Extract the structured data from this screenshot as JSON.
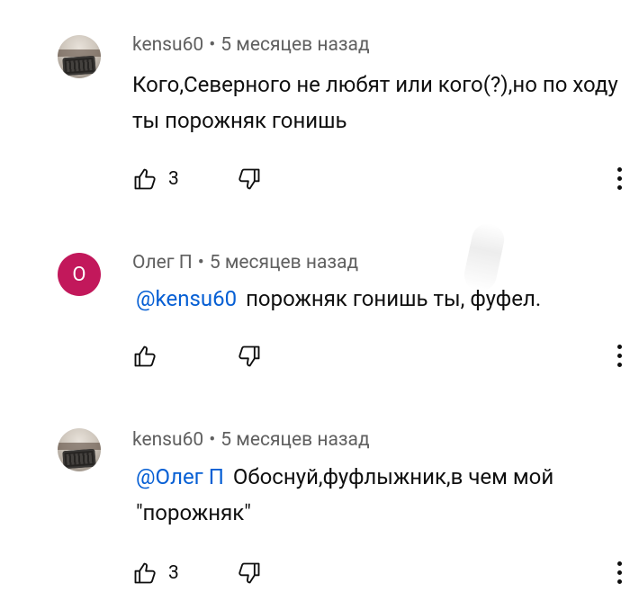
{
  "comments": [
    {
      "author": "kensu60",
      "time": "5 месяцев назад",
      "mention": "",
      "text": "Кого,Северного не любят или кого(?),но по ходу ты порожняк гонишь",
      "likes": "3",
      "avatar": "keyboard-photo"
    },
    {
      "author": "Олег П",
      "time": "5 месяцев назад",
      "mention": "@kensu60",
      "text": "порожняк гонишь ты, фуфел.",
      "likes": "",
      "avatar_letter": "О",
      "avatar_color": "#c2185b"
    },
    {
      "author": "kensu60",
      "time": "5 месяцев назад",
      "mention": "@Олег П",
      "text": "Обоснуй,фуфлыжник,в чем мой \"порожняк\"",
      "likes": "3",
      "avatar": "keyboard-photo"
    }
  ],
  "separator": "•",
  "colors": {
    "mention": "#065fd4",
    "meta": "#606060",
    "avatar_o": "#c2185b"
  }
}
